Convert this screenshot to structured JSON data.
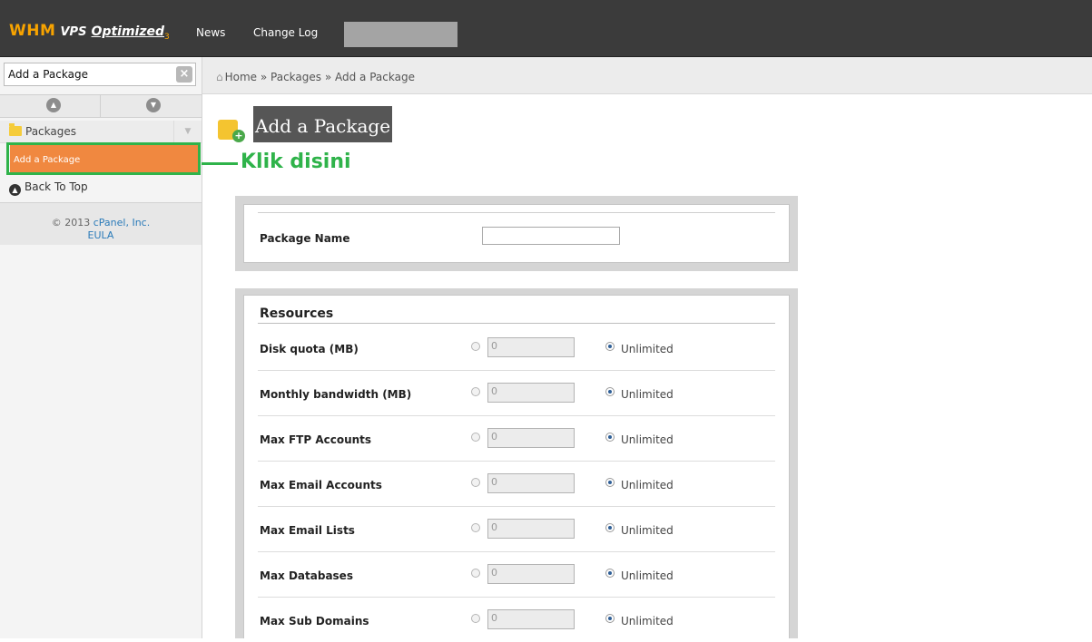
{
  "header": {
    "logo": {
      "whm": "WHM",
      "vps": "VPS",
      "optimized": "Optimized",
      "version": "3"
    },
    "nav": [
      "News",
      "Change Log"
    ]
  },
  "sidebar": {
    "search_value": "Add a Package",
    "category": "Packages",
    "active_item": "Add a Package",
    "back_to_top": "Back To Top",
    "copyright_prefix": "© 2013",
    "copyright_link": "cPanel, Inc.",
    "eula": "EULA"
  },
  "breadcrumb": "Home » Packages » Add a Package",
  "page_title": "Add a Package",
  "annotation": "Klik disini",
  "form": {
    "package_name_label": "Package Name",
    "resources_title": "Resources",
    "resources": [
      {
        "label": "Disk quota (MB)",
        "value": "0",
        "unlimited": "Unlimited"
      },
      {
        "label": "Monthly bandwidth (MB)",
        "value": "0",
        "unlimited": "Unlimited"
      },
      {
        "label": "Max FTP Accounts",
        "value": "0",
        "unlimited": "Unlimited"
      },
      {
        "label": "Max Email Accounts",
        "value": "0",
        "unlimited": "Unlimited"
      },
      {
        "label": "Max Email Lists",
        "value": "0",
        "unlimited": "Unlimited"
      },
      {
        "label": "Max Databases",
        "value": "0",
        "unlimited": "Unlimited"
      },
      {
        "label": "Max Sub Domains",
        "value": "0",
        "unlimited": "Unlimited"
      }
    ]
  },
  "colors": {
    "topbar": "#3b3b3b",
    "logo_accent": "#f7a300",
    "active_item": "#f08840",
    "annotation_green": "#2fb34a"
  }
}
